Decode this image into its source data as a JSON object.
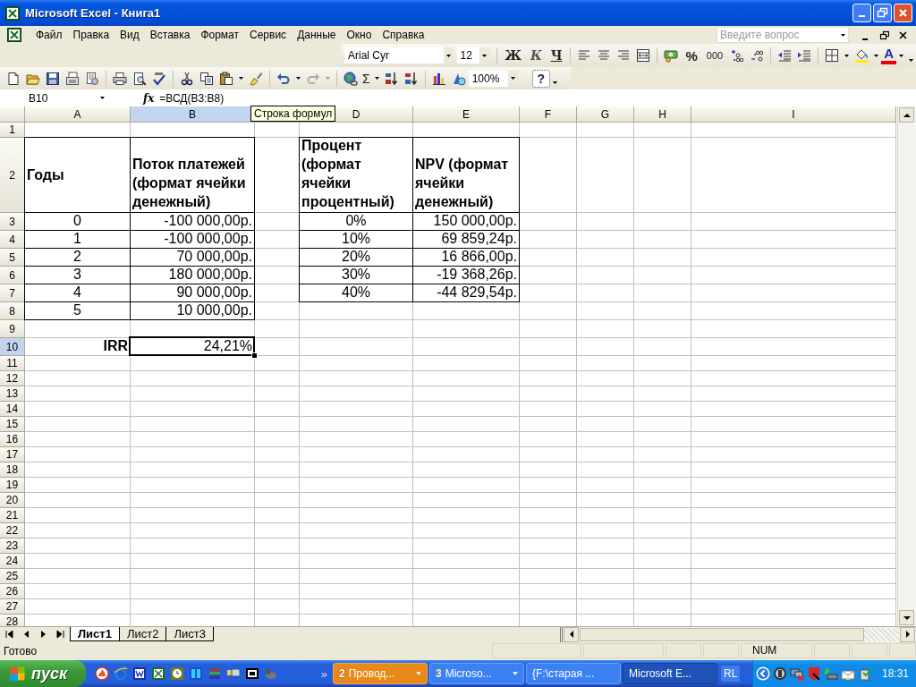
{
  "window": {
    "title": "Microsoft Excel - Книга1"
  },
  "menu": [
    "Файл",
    "Правка",
    "Вид",
    "Вставка",
    "Формат",
    "Сервис",
    "Данные",
    "Окно",
    "Справка"
  ],
  "help_box": {
    "placeholder": "Введите вопрос"
  },
  "formatting_toolbar": {
    "font": "Arial Cyr",
    "size": "12",
    "bold": "Ж",
    "italic": "К",
    "underline": "Ч",
    "percent": "%",
    "thousands": "000",
    "font_color": "A"
  },
  "standard_toolbar": {
    "autosum": "Σ",
    "zoom": "100%",
    "help": "?"
  },
  "formula_bar": {
    "cell": "B10",
    "fx": "fx",
    "formula": "=ВСД(B3:B8)"
  },
  "tooltip": "Строка формул",
  "sheet": {
    "columns": [
      {
        "kind": "column",
        "label": "A",
        "selected": false
      },
      {
        "kind": "column",
        "label": "B",
        "selected": true
      },
      {
        "kind": "covered"
      },
      {
        "kind": "column",
        "label": "D",
        "selected": false
      },
      {
        "kind": "column",
        "label": "E",
        "selected": false
      },
      {
        "kind": "column",
        "label": "F",
        "selected": false
      },
      {
        "kind": "column",
        "label": "G",
        "selected": false
      },
      {
        "kind": "column",
        "label": "H",
        "selected": false
      },
      {
        "kind": "column",
        "label": "I",
        "selected": false
      }
    ],
    "rows": [
      {
        "number": "1",
        "selected": false
      },
      {
        "number": "2",
        "selected": false,
        "cells": [
          {
            "kind": "header_middle",
            "text": "Годы",
            "selected": false
          },
          {
            "kind": "header",
            "text": "Поток платежей (формат ячейки денежный)",
            "selected": false
          },
          {
            "kind": "empty"
          },
          {
            "kind": "header",
            "text": "Процент (формат ячейки процентный)",
            "selected": false
          },
          {
            "kind": "header",
            "text": "NPV (формат ячейки денежный)",
            "selected": false
          }
        ]
      },
      {
        "number": "3",
        "selected": false,
        "cells": [
          {
            "kind": "number",
            "text": "0",
            "selected": false
          },
          {
            "kind": "amount",
            "text": "-100 000,00р.",
            "selected": false
          },
          {
            "kind": "empty"
          },
          {
            "kind": "number",
            "text": "0%",
            "selected": false
          },
          {
            "kind": "amount",
            "text": "150 000,00р.",
            "selected": false
          }
        ]
      },
      {
        "number": "4",
        "selected": false,
        "cells": [
          {
            "kind": "number",
            "text": "1",
            "selected": false
          },
          {
            "kind": "amount",
            "text": "-100 000,00р.",
            "selected": false
          },
          {
            "kind": "empty"
          },
          {
            "kind": "number",
            "text": "10%",
            "selected": false
          },
          {
            "kind": "amount",
            "text": "69 859,24р.",
            "selected": false
          }
        ]
      },
      {
        "number": "5",
        "selected": false,
        "cells": [
          {
            "kind": "number",
            "text": "2",
            "selected": false
          },
          {
            "kind": "amount",
            "text": "70 000,00р.",
            "selected": false
          },
          {
            "kind": "empty"
          },
          {
            "kind": "number",
            "text": "20%",
            "selected": false
          },
          {
            "kind": "amount",
            "text": "16 866,00р.",
            "selected": false
          }
        ]
      },
      {
        "number": "6",
        "selected": false,
        "cells": [
          {
            "kind": "number",
            "text": "3",
            "selected": false
          },
          {
            "kind": "amount",
            "text": "180 000,00р.",
            "selected": false
          },
          {
            "kind": "empty"
          },
          {
            "kind": "number",
            "text": "30%",
            "selected": false
          },
          {
            "kind": "amount",
            "text": "-19 368,26р.",
            "selected": false
          }
        ]
      },
      {
        "number": "7",
        "selected": false,
        "cells": [
          {
            "kind": "number",
            "text": "4",
            "selected": false
          },
          {
            "kind": "amount",
            "text": "90 000,00р.",
            "selected": false
          },
          {
            "kind": "empty"
          },
          {
            "kind": "number",
            "text": "40%",
            "selected": false
          },
          {
            "kind": "amount",
            "text": "-44 829,54р.",
            "selected": false
          }
        ]
      },
      {
        "number": "8",
        "selected": false,
        "cells": [
          {
            "kind": "number",
            "text": "5",
            "selected": false
          },
          {
            "kind": "amount",
            "text": "10 000,00р.",
            "selected": false
          }
        ]
      },
      {
        "number": "9",
        "selected": false
      },
      {
        "number": "10",
        "selected": true,
        "cells": [
          {
            "kind": "label",
            "text": "IRR",
            "selected": false
          },
          {
            "kind": "result",
            "text": "24,21%",
            "selected": true
          }
        ]
      },
      {
        "number": "11",
        "selected": false
      },
      {
        "number": "12",
        "selected": false
      },
      {
        "number": "13",
        "selected": false
      },
      {
        "number": "14",
        "selected": false
      },
      {
        "number": "15",
        "selected": false
      },
      {
        "number": "16",
        "selected": false
      },
      {
        "number": "17",
        "selected": false
      },
      {
        "number": "18",
        "selected": false
      },
      {
        "number": "19",
        "selected": false
      },
      {
        "number": "20",
        "selected": false
      },
      {
        "number": "21",
        "selected": false
      },
      {
        "number": "22",
        "selected": false
      },
      {
        "number": "23",
        "selected": false
      },
      {
        "number": "24",
        "selected": false
      },
      {
        "number": "25",
        "selected": false
      },
      {
        "number": "26",
        "selected": false
      },
      {
        "number": "27",
        "selected": false
      },
      {
        "number": "28",
        "selected": false
      }
    ]
  },
  "sheet_tabs": [
    {
      "label": "Лист1",
      "selected": true
    },
    {
      "label": "Лист2",
      "selected": false
    },
    {
      "label": "Лист3",
      "selected": false
    }
  ],
  "status_bar": {
    "message": "Готово",
    "indicator": "NUM"
  },
  "taskbar": {
    "start": "пуск",
    "more": "»",
    "tasks": [
      {
        "kind": "group",
        "count": "2",
        "label": "Провод...",
        "highlighted": true,
        "selected": false
      },
      {
        "kind": "group",
        "count": "3",
        "label": "Microso...",
        "highlighted": false,
        "selected": false
      },
      {
        "kind": "window",
        "label": "{F:\\старая ...",
        "highlighted": false,
        "selected": false
      },
      {
        "kind": "window",
        "label": "Microsoft E...",
        "highlighted": false,
        "selected": true
      }
    ],
    "language": "RL",
    "clock": "18:31"
  }
}
